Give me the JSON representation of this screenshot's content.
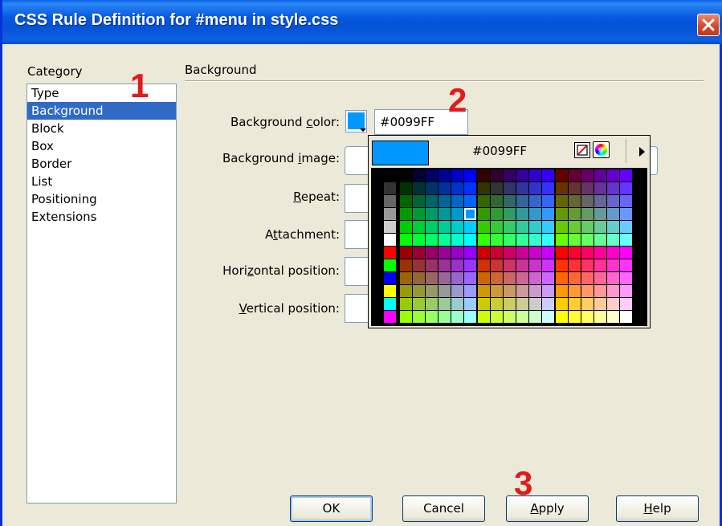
{
  "window": {
    "title": "CSS Rule Definition for #menu in style.css"
  },
  "category": {
    "label": "Category",
    "items": [
      {
        "label": "Type",
        "selected": false
      },
      {
        "label": "Background",
        "selected": true
      },
      {
        "label": "Block",
        "selected": false
      },
      {
        "label": "Box",
        "selected": false
      },
      {
        "label": "Border",
        "selected": false
      },
      {
        "label": "List",
        "selected": false
      },
      {
        "label": "Positioning",
        "selected": false
      },
      {
        "label": "Extensions",
        "selected": false
      }
    ]
  },
  "panel": {
    "heading": "Background",
    "fields": {
      "bg_color": {
        "pre": "Background ",
        "key": "c",
        "post": "olor:",
        "value": "#0099FF"
      },
      "bg_image": {
        "pre": "Background ",
        "key": "i",
        "post": "mage:"
      },
      "repeat": {
        "pre": "",
        "key": "R",
        "post": "epeat:"
      },
      "attachment": {
        "pre": "A",
        "key": "t",
        "post": "tachment:"
      },
      "hpos": {
        "pre": "Hori",
        "key": "z",
        "post": "ontal position:"
      },
      "vpos": {
        "pre": "",
        "key": "V",
        "post": "ertical position:"
      }
    }
  },
  "picker": {
    "hex": "#0099FF",
    "current_color": "#0099FF",
    "icons": [
      "no-color-icon",
      "color-wheel-icon",
      "menu-arrow-icon"
    ]
  },
  "buttons": {
    "ok": "OK",
    "cancel": "Cancel",
    "apply": {
      "pre": "",
      "key": "A",
      "post": "pply"
    },
    "help": {
      "pre": "",
      "key": "H",
      "post": "elp"
    }
  },
  "annotations": [
    "1",
    "2",
    "3"
  ],
  "colors": {
    "selection": "#316ac5",
    "annotation": "#e21a1a",
    "titlebar": "#0658df"
  }
}
